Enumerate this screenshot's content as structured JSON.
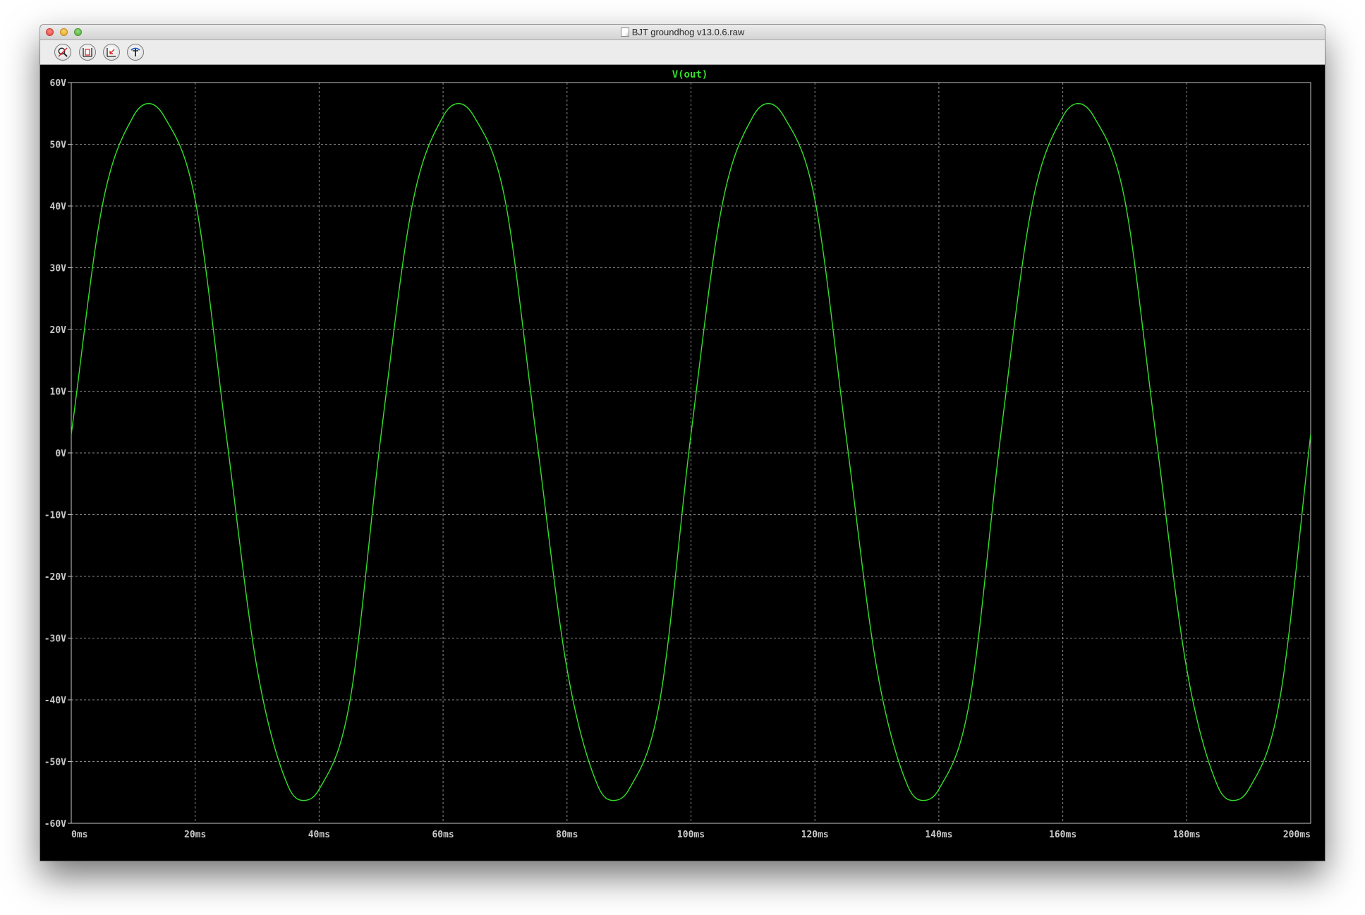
{
  "window": {
    "title": "BJT groundhog v13.0.6.raw"
  },
  "toolbar": {
    "buttons": [
      {
        "name": "zoom-area-icon"
      },
      {
        "name": "zoom-fit-icon"
      },
      {
        "name": "zoom-back-icon"
      },
      {
        "name": "probe-tool-icon"
      }
    ]
  },
  "colors": {
    "trace": "#33e02a",
    "grid": "#8a8a8a",
    "axis_text": "#c8c8c8",
    "background": "#000000"
  },
  "chart_data": {
    "type": "line",
    "title": "V(out)",
    "xlabel": "",
    "ylabel": "",
    "xlim": [
      0,
      200
    ],
    "ylim": [
      -60,
      60
    ],
    "x_ticks": [
      "0ms",
      "20ms",
      "40ms",
      "60ms",
      "80ms",
      "100ms",
      "120ms",
      "140ms",
      "160ms",
      "180ms",
      "200ms"
    ],
    "y_ticks": [
      "60V",
      "50V",
      "40V",
      "30V",
      "20V",
      "10V",
      "0V",
      "-10V",
      "-20V",
      "-30V",
      "-40V",
      "-50V",
      "-60V"
    ],
    "grid": true,
    "x_unit": "ms",
    "y_unit": "V",
    "series": [
      {
        "name": "V(out)",
        "x": [
          0,
          5,
          10,
          12.5,
          15,
          20,
          25,
          30,
          35,
          37.5,
          40,
          45,
          50,
          55,
          60,
          62.5,
          65,
          70,
          75,
          80,
          85,
          87.5,
          90,
          95,
          100,
          105,
          110,
          112.5,
          115,
          120,
          125,
          130,
          135,
          137.5,
          140,
          145,
          150,
          155,
          160,
          162.5,
          165,
          170,
          175,
          180,
          185,
          187.5,
          190,
          195,
          200
        ],
        "y": [
          3,
          40,
          54.5,
          56.6,
          54.5,
          41,
          3,
          -35,
          -54,
          -56.3,
          -54.5,
          -40,
          3,
          40,
          54.5,
          56.6,
          54.5,
          41,
          3,
          -35,
          -54,
          -56.3,
          -54.5,
          -40,
          3,
          40,
          54.5,
          56.6,
          54.5,
          41,
          3,
          -35,
          -54,
          -56.3,
          -54.5,
          -40,
          3,
          40,
          54.5,
          56.6,
          54.5,
          41,
          3,
          -35,
          -54,
          -56.3,
          -54.5,
          -40,
          3
        ]
      }
    ]
  }
}
